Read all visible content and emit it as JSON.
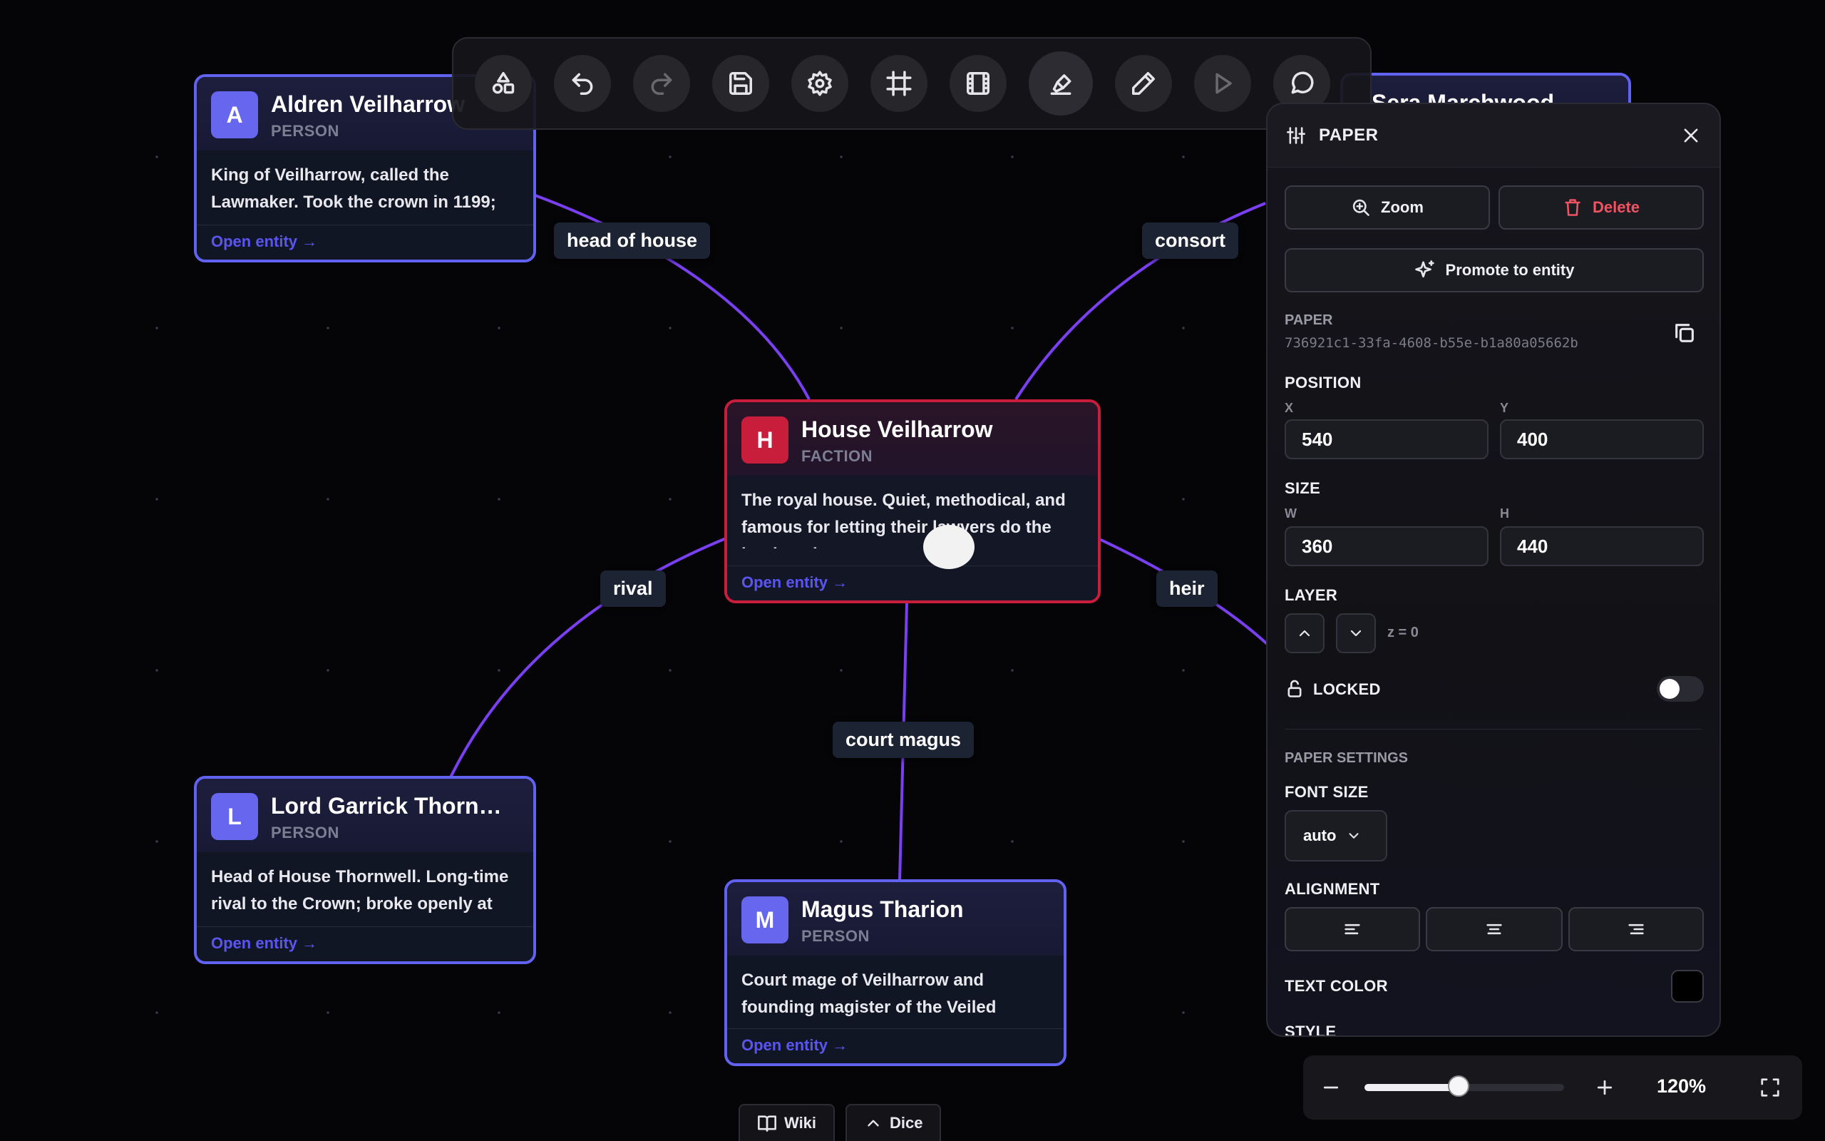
{
  "toolbar": {
    "tools": [
      "shapes-icon",
      "undo-icon",
      "redo-icon",
      "save-icon",
      "settings-icon",
      "frame-icon",
      "film-icon",
      "highlighter-icon",
      "pencil-icon",
      "play-icon",
      "comment-icon"
    ]
  },
  "edges": [
    {
      "label": "head of house"
    },
    {
      "label": "consort"
    },
    {
      "label": "rival"
    },
    {
      "label": "heir"
    },
    {
      "label": "court magus"
    }
  ],
  "cards": {
    "aldren": {
      "initial": "A",
      "title": "Aldren Veilharrow",
      "type": "PERSON",
      "body": "King of Veilharrow, called the Lawmaker. Took the crown in 1199;",
      "link": "Open entity →"
    },
    "sera": {
      "title": "Sera Marchwood"
    },
    "house": {
      "initial": "H",
      "title": "House Veilharrow",
      "type": "FACTION",
      "body": "The royal house. Quiet, methodical, and famous for letting their lawyers do the loud work.",
      "link": "Open entity →"
    },
    "garrick": {
      "initial": "L",
      "title": "Lord Garrick Thorn…",
      "type": "PERSON",
      "body": "Head of House Thornwell. Long-time rival to the Crown; broke openly at",
      "link": "Open entity →"
    },
    "magus": {
      "initial": "M",
      "title": "Magus Tharion",
      "type": "PERSON",
      "body": "Court mage of Veilharrow and founding magister of the Veiled Circle. Forged",
      "link": "Open entity →"
    }
  },
  "panel": {
    "title": "PAPER",
    "zoom_label": "Zoom",
    "delete_label": "Delete",
    "promote_label": "Promote to entity",
    "id_label": "PAPER",
    "id_value": "736921c1-33fa-4608-b55e-b1a80a05662b",
    "position_label": "POSITION",
    "x_label": "X",
    "x_value": "540",
    "y_label": "Y",
    "y_value": "400",
    "size_label": "SIZE",
    "w_label": "W",
    "w_value": "360",
    "h_label": "H",
    "h_value": "440",
    "layer_label": "LAYER",
    "z_text": "z = 0",
    "locked_label": "LOCKED",
    "locked": false,
    "paper_settings_label": "PAPER SETTINGS",
    "font_size_label": "FONT SIZE",
    "font_size_value": "auto",
    "alignment_label": "ALIGNMENT",
    "text_color_label": "TEXT COLOR",
    "style_label": "STYLE"
  },
  "zoom": {
    "value": "120%",
    "level": 0.47
  },
  "bottom": {
    "wiki_label": "Wiki",
    "dice_label": "Dice"
  },
  "colors": {
    "accent": "#6262f0",
    "faction": "#c81e3b",
    "edge": "#7b3ff2",
    "danger": "#f05462"
  }
}
